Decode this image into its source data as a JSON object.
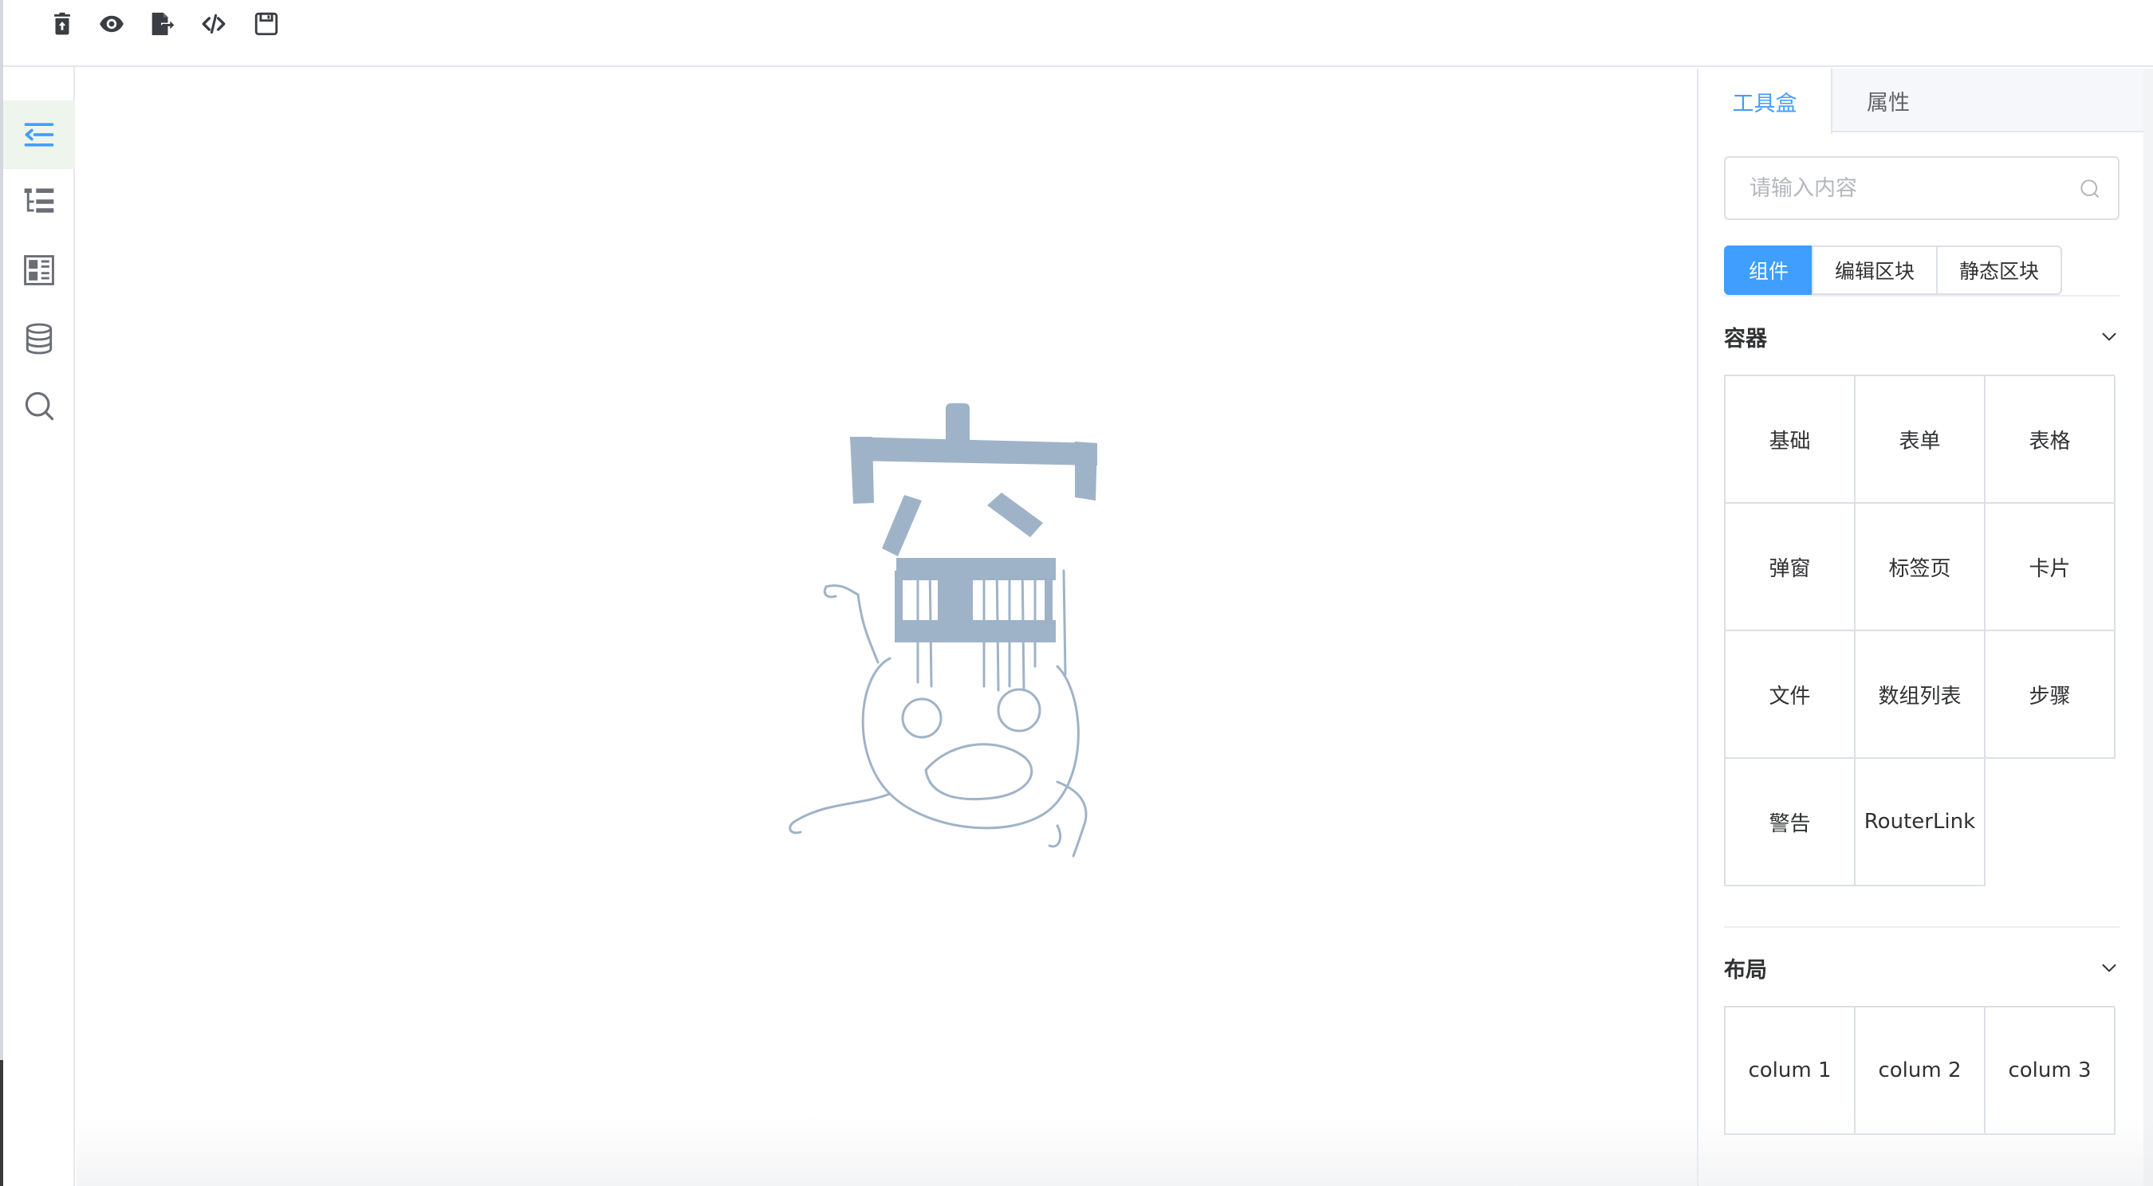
{
  "toolbar": {
    "buttons": [
      {
        "name": "clear-icon"
      },
      {
        "name": "preview-icon"
      },
      {
        "name": "export-icon"
      },
      {
        "name": "code-icon"
      },
      {
        "name": "save-icon"
      }
    ]
  },
  "rail": {
    "items": [
      {
        "name": "collapse-menu-icon",
        "active": true
      },
      {
        "name": "tree-structure-icon",
        "active": false
      },
      {
        "name": "layout-blocks-icon",
        "active": false
      },
      {
        "name": "database-icon",
        "active": false
      },
      {
        "name": "search-icon",
        "active": false
      }
    ]
  },
  "panel": {
    "tabs": [
      "工具盒",
      "属性"
    ],
    "search_placeholder": "请输入内容",
    "segments": [
      "组件",
      "编辑区块",
      "静态区块"
    ],
    "sections": [
      {
        "title": "容器",
        "items": [
          "基础",
          "表单",
          "表格",
          "弹窗",
          "标签页",
          "卡片",
          "文件",
          "数组列表",
          "步骤",
          "警告",
          "RouterLink"
        ]
      },
      {
        "title": "布局",
        "items": [
          "colum 1",
          "colum 2",
          "colum 3"
        ]
      }
    ]
  },
  "colors": {
    "accent": "#409eff",
    "illustration": "#9fb3c8",
    "rail_active_bg": "#eef5ec"
  }
}
